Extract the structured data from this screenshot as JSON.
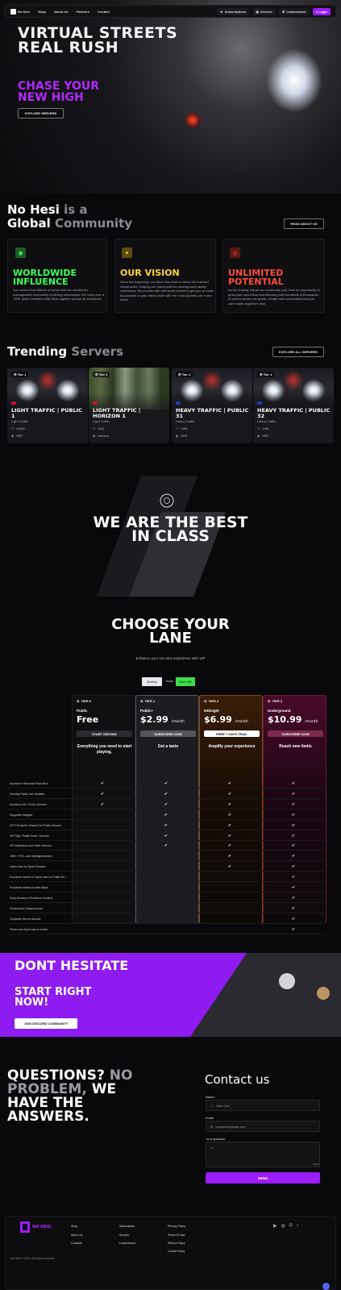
{
  "nav": {
    "brand": "No Hesi",
    "links": [
      "Shop",
      "About Us",
      "Partners",
      "Contact"
    ],
    "right": [
      "Subscriptions",
      "Servers",
      "Leaderboard"
    ],
    "login": "Login"
  },
  "hero": {
    "line1": "VIRTUAL STREETS",
    "line2": "REAL RUSH",
    "tag1": "CHASE YOUR",
    "tag2": "NEW HIGH",
    "button": "EXPLORE SERVERS"
  },
  "community": {
    "title_a": "No Hesi",
    "title_b": "is a",
    "title_c": "Global",
    "title_d": "Community",
    "button": "READ ABOUT US",
    "cards": [
      {
        "title1": "WORLDWIDE",
        "title2": "INFLUENCE",
        "color": "#3dff5a",
        "icon": "globe-icon",
        "text": "Our content has billions of views and has created an unimaginable community of driving enthusiasts. We have over a 700K active members that drive together across all continents."
      },
      {
        "title1": "OUR VISION",
        "title2": "",
        "color": "#ffd43b",
        "icon": "lightbulb-icon",
        "text": "Since the beginning, our vision has been to blend the real and virtual world, shaping our brand with the underground racing community. We provide with real world brands to get you as close as possible to your dream build with the most dynamic car in the world."
      },
      {
        "title1": "UNLIMITED",
        "title2": "POTENTIAL",
        "color": "#ff4a3a",
        "icon": "target-icon",
        "text": "As the leading Virtual car community, you have an opportunity to grow your new friend and following with hundreds of thousands of drivers across the globe. Create new connections that you can't make anywhere else."
      }
    ]
  },
  "trending": {
    "title_a": "Trending",
    "title_b": "Servers",
    "button": "EXPLORE ALL SERVERS",
    "servers": [
      {
        "tier": "Tier 1",
        "name": "LIGHT TRAFFIC | PUBLIC 1",
        "traffic": "Light Traffic",
        "players": "61/93",
        "map": "SRP",
        "flag": "uk"
      },
      {
        "tier": "Tier 1",
        "name": "LIGHT TRAFFIC | HORIZON 1",
        "traffic": "Light Traffic",
        "players": "0/10",
        "map": "Horizon",
        "flag": "uk"
      },
      {
        "tier": "Tier 1",
        "name": "HEAVY TRAFFIC | PUBLIC 31",
        "traffic": "Heavy Traffic",
        "players": "1/95",
        "map": "SRP",
        "flag": "eu"
      },
      {
        "tier": "Tier 1",
        "name": "HEAVY TRAFFIC | PUBLIC 32",
        "traffic": "Heavy Traffic",
        "players": "1/95",
        "map": "SRP",
        "flag": "eu"
      }
    ]
  },
  "best": {
    "line1": "WE ARE THE BEST",
    "line2": "IN CLASS"
  },
  "pricing": {
    "title1": "CHOOSE YOUR",
    "title2": "LANE",
    "subtitle": "Enhance your No Hesi experience with VIP",
    "toggle": {
      "monthly": "Monthly",
      "yearly": "Yearly",
      "save": "Save 15%"
    },
    "tiers": [
      {
        "tier": "TIER 0",
        "name": "Public",
        "price": "Free",
        "period": "",
        "button": "START DRIVING",
        "tagline": "Everything you need to start playing."
      },
      {
        "tier": "TIER 1",
        "name": "Public+",
        "price": "$2.99",
        "period": "/month",
        "button": "SUBSCRIBE NOW",
        "tagline": "Get a taste"
      },
      {
        "tier": "TIER 2",
        "name": "Midnight",
        "price": "$6.99",
        "period": "/month",
        "button": "FREE 7 DAYS TRIAL",
        "tagline": "Amplify your experience"
      },
      {
        "tier": "TIER 3",
        "name": "Underground",
        "price": "$10.99",
        "period": "/month",
        "button": "SUBSCRIBE NOW",
        "tagline": "Reach new limits"
      }
    ],
    "features": [
      {
        "label": "Access to Heat and Race Mod",
        "tiers": [
          1,
          1,
          1,
          1
        ]
      },
      {
        "label": "Monthly Public Car Updates",
        "tiers": [
          1,
          1,
          1,
          1
        ]
      },
      {
        "label": "Access to 90+ Public Servers",
        "tiers": [
          1,
          1,
          1,
          1
        ]
      },
      {
        "label": "Supporter Badges",
        "tiers": [
          0,
          1,
          1,
          1
        ]
      },
      {
        "label": "VIP Priority for Global Car Public Servers",
        "tiers": [
          0,
          1,
          1,
          1
        ]
      },
      {
        "label": "VIP Skip \"Public Rush\" Servers",
        "tiers": [
          0,
          1,
          1,
          1
        ]
      },
      {
        "label": "VIP Adventure and Other Servers",
        "tiers": [
          0,
          1,
          1,
          1
        ]
      },
      {
        "label": "JDM, VTEC, and Midnight servers",
        "tiers": [
          0,
          0,
          1,
          1
        ]
      },
      {
        "label": "Open Cars for Sport Servers",
        "tiers": [
          0,
          0,
          1,
          1
        ]
      },
      {
        "label": "Exclusive access to Sport cars on Public Se...",
        "tiers": [
          0,
          0,
          0,
          1
        ]
      },
      {
        "label": "Exclusive access to new Maps",
        "tiers": [
          0,
          0,
          0,
          1
        ]
      },
      {
        "label": "Early Access to Exclusive Content",
        "tiers": [
          0,
          0,
          0,
          1
        ]
      },
      {
        "label": "Community Voting Access",
        "tiers": [
          0,
          0,
          0,
          1
        ]
      },
      {
        "label": "Complete Server Access",
        "tiers": [
          0,
          0,
          0,
          1
        ]
      },
      {
        "label": "Three new Sport cars a month",
        "tiers": [
          0,
          0,
          0,
          1
        ]
      }
    ]
  },
  "cta": {
    "line1": "DONT HESITATE",
    "line2": "START RIGHT",
    "line3": "NOW!",
    "button": "JOIN DISCORD COMMUNITY"
  },
  "faq": {
    "l1a": "QUESTIONS?",
    "l1b": "NO",
    "l2a": "PROBLEM,",
    "l2b": "WE",
    "l3": "HAVE THE",
    "l4": "ANSWERS."
  },
  "contact": {
    "title": "Contact us",
    "name_label": "Name",
    "name_placeholder": "John Doe",
    "email_label": "Email",
    "email_placeholder": "example@gmail.com",
    "question_label": "Your question",
    "counter": "0/500",
    "send": "SEND"
  },
  "footer": {
    "brand": "NO HESI",
    "col1": [
      "Shop",
      "About Us",
      "Contacts"
    ],
    "col2": [
      "Subscription",
      "Servers",
      "Leaderboard"
    ],
    "col3": [
      "Privacy Policy",
      "Terms Of Use",
      "Refund Policy",
      "Cookie Policy"
    ],
    "copyright": "No Hesi™ 2024. All rights reserved"
  }
}
